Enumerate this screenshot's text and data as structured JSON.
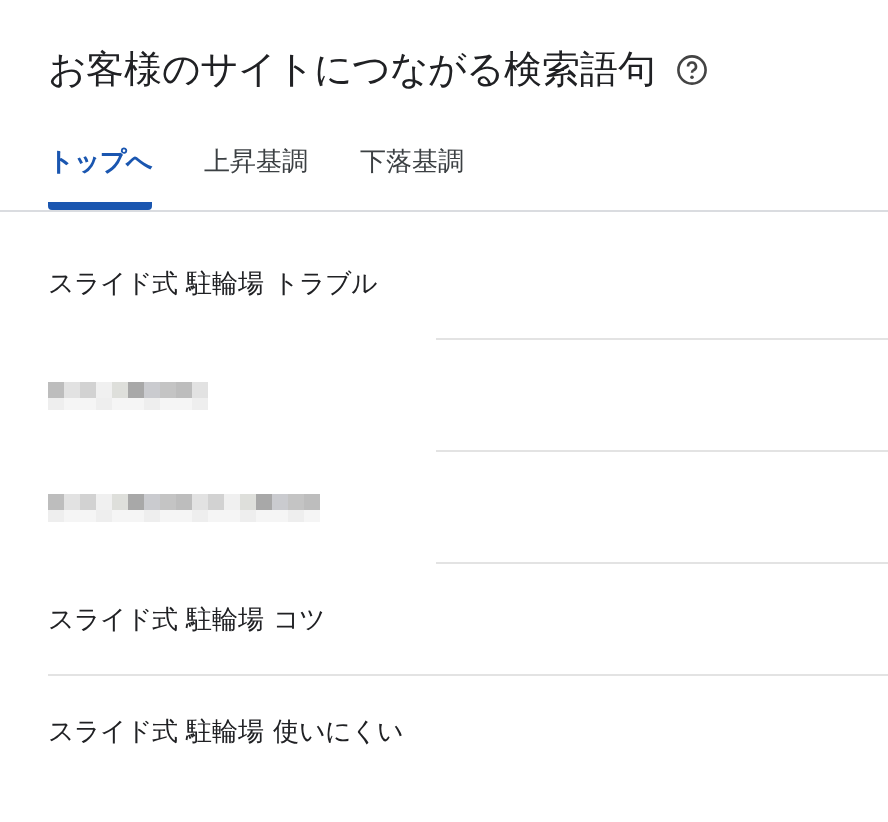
{
  "title": "お客様のサイトにつながる検索語句",
  "tabs": [
    {
      "label": "トップへ",
      "selected": true
    },
    {
      "label": "上昇基調",
      "selected": false
    },
    {
      "label": "下落基調",
      "selected": false
    }
  ],
  "rows": [
    {
      "kind": "text",
      "text": "スライド式 駐輪場 トラブル"
    },
    {
      "kind": "redacted"
    },
    {
      "kind": "redacted"
    },
    {
      "kind": "text",
      "text": "スライド式 駐輪場 コツ"
    },
    {
      "kind": "text",
      "text": "スライド式 駐輪場 使いにくい"
    }
  ]
}
